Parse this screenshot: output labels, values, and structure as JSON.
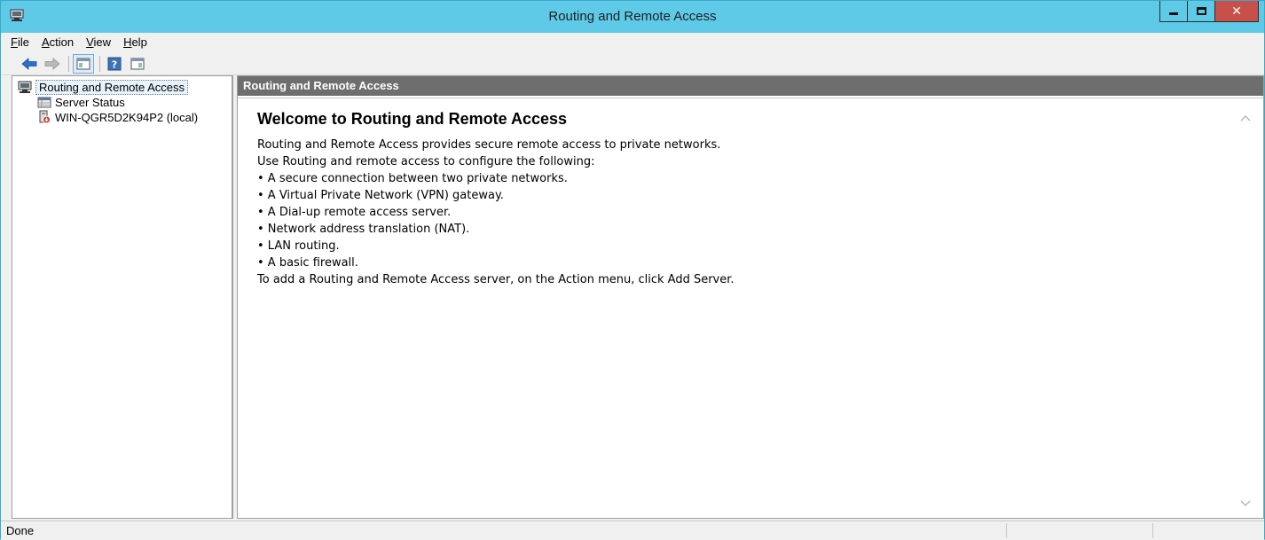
{
  "window": {
    "title": "Routing and Remote Access",
    "icon": "routing-remote-access-icon",
    "buttons": {
      "minimize": "minimize-icon",
      "maximize": "maximize-icon",
      "close": "close-icon"
    }
  },
  "menubar": {
    "items": [
      {
        "label": "File"
      },
      {
        "label": "Action"
      },
      {
        "label": "View"
      },
      {
        "label": "Help"
      }
    ]
  },
  "toolbar": {
    "buttons": [
      "back-arrow-icon",
      "forward-arrow-icon",
      "show-hide-console-tree-icon",
      "help-icon",
      "show-hide-action-pane-icon"
    ]
  },
  "tree": {
    "root": {
      "label": "Routing and Remote Access",
      "icon": "routing-remote-access-icon"
    },
    "children": [
      {
        "label": "Server Status",
        "icon": "server-status-icon"
      },
      {
        "label": "WIN-QGR5D2K94P2 (local)",
        "icon": "server-down-icon"
      }
    ]
  },
  "content": {
    "header": "Routing and Remote Access",
    "title": "Welcome to Routing and Remote Access",
    "lines": [
      "Routing and Remote Access provides secure remote access to private networks.",
      "Use Routing and remote access to configure the following:",
      "• A secure connection between two private networks.",
      "• A Virtual Private Network (VPN) gateway.",
      "• A Dial-up remote access server.",
      "• Network address translation (NAT).",
      "• LAN routing.",
      "• A basic firewall.",
      "To add a Routing and Remote Access server, on the Action menu, click Add Server."
    ]
  },
  "statusbar": {
    "text": "Done"
  },
  "colors": {
    "titlebar": "#5fcae8",
    "close": "#c7504a",
    "content_header": "#6e6e6e"
  }
}
